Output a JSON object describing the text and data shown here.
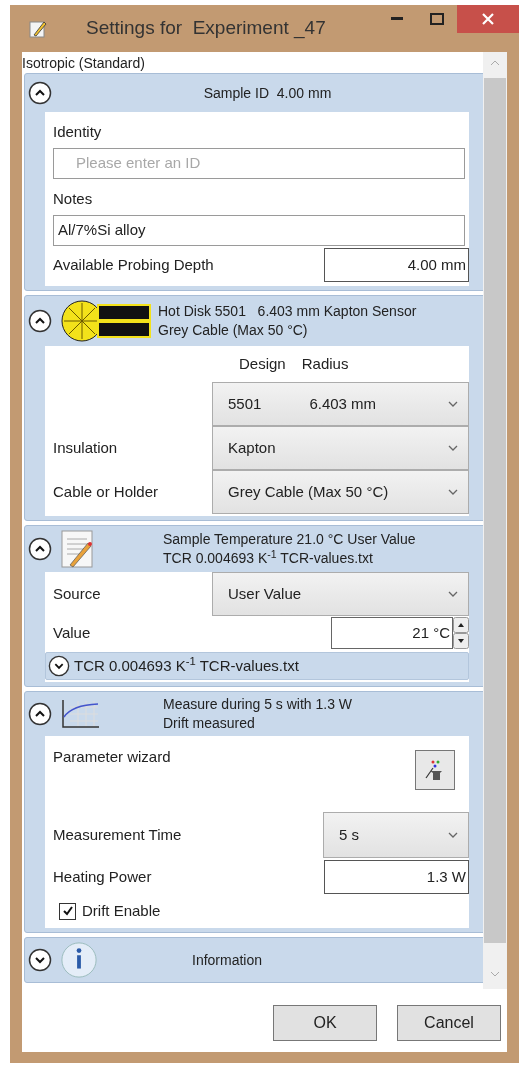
{
  "window": {
    "title": "Settings for  Experiment _47"
  },
  "material": "Isotropic (Standard)",
  "sections": [
    {
      "kind": "sample",
      "expanded": true,
      "header_lines": [
        "Sample ID  4.00 mm"
      ],
      "rows": [
        {
          "kind": "heading",
          "label": "Identity"
        },
        {
          "kind": "textbox",
          "placeholder": "Please enter an ID"
        },
        {
          "kind": "heading",
          "label": "Notes"
        },
        {
          "kind": "textbox",
          "value": "Al/7%Si alloy"
        },
        {
          "kind": "labeled_input",
          "label": "Available Probing Depth",
          "value": "4.00 mm"
        }
      ]
    },
    {
      "kind": "sensor",
      "expanded": true,
      "header_lines": [
        "Hot Disk 5501   6.403 mm Kapton Sensor",
        "Grey Cable (Max 50 °C)"
      ],
      "rows": [
        {
          "kind": "column_heads",
          "labels": [
            "Design",
            "Radius"
          ]
        },
        {
          "kind": "dropdown",
          "values": [
            "5501",
            "6.403 mm"
          ]
        },
        {
          "kind": "dropdown",
          "label": "Insulation",
          "values": [
            "Kapton"
          ]
        },
        {
          "kind": "dropdown",
          "label": "Cable or Holder",
          "values": [
            "Grey Cable (Max 50 °C)"
          ]
        }
      ]
    },
    {
      "kind": "temperature",
      "expanded": true,
      "header_lines": [
        "Sample Temperature 21.0 °C User Value",
        "TCR 0.004693 K$^{-1}$ TCR-values.txt"
      ],
      "rows": [
        {
          "kind": "dropdown",
          "label": "Source",
          "values": [
            "User Value"
          ]
        },
        {
          "kind": "spinner",
          "label": "Value",
          "value": "21 °C"
        },
        {
          "kind": "subsection",
          "expanded": false,
          "text": "TCR 0.004693 K$^{-1}$ TCR-values.txt"
        }
      ]
    },
    {
      "kind": "measurement",
      "expanded": true,
      "header_lines": [
        "Measure during 5 s with 1.3 W",
        "Drift measured"
      ],
      "rows": [
        {
          "kind": "wizard",
          "label": "Parameter wizard"
        },
        {
          "kind": "short_dropdown",
          "label": "Measurement Time",
          "values": [
            "5 s"
          ]
        },
        {
          "kind": "labeled_input",
          "label": "Heating Power",
          "value": "1.3 W"
        },
        {
          "kind": "checkbox",
          "label": "Drift Enable",
          "checked": true
        }
      ]
    },
    {
      "kind": "information",
      "expanded": false,
      "header_lines": [
        "Information"
      ]
    }
  ],
  "buttons": [
    "OK",
    "Cancel"
  ]
}
